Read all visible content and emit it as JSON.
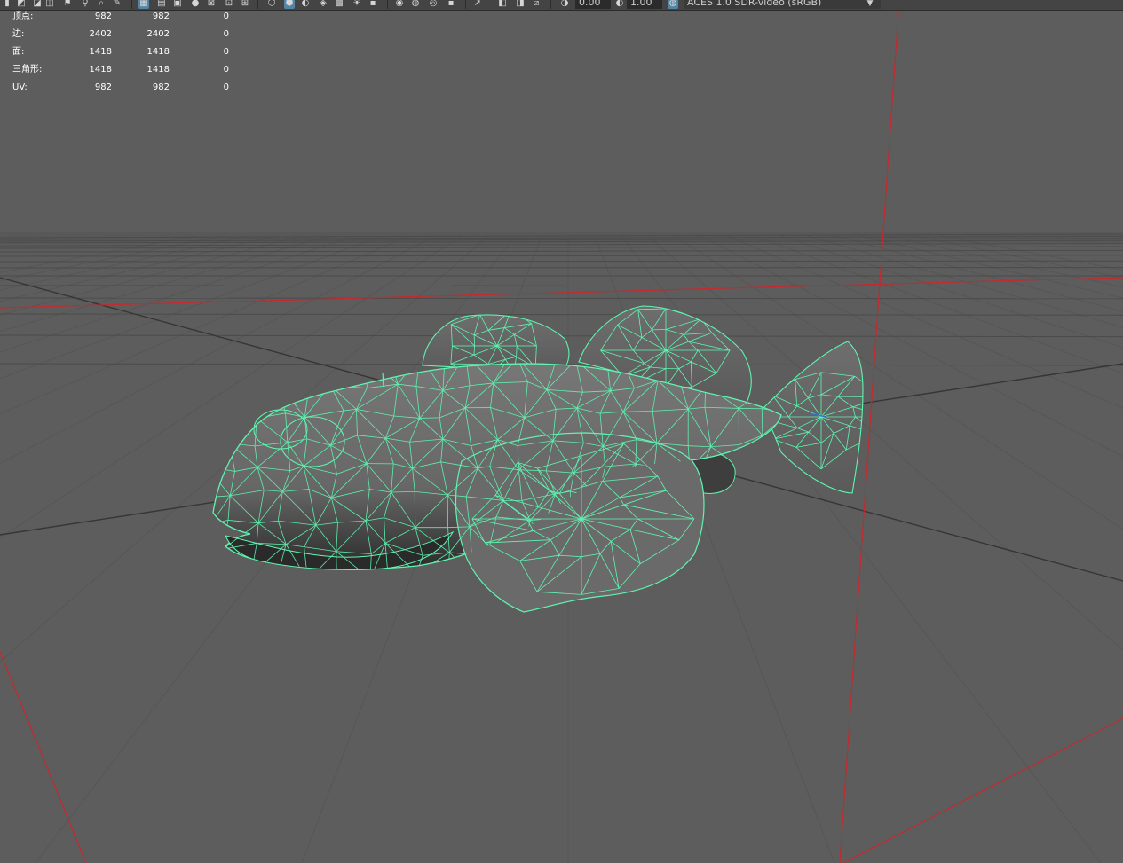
{
  "toolbar": {
    "exposure_value": "0.00",
    "gamma_value": "1.00",
    "colorspace_label": "ACES 1.0 SDR-video (sRGB)",
    "icons": [
      "camera-icon",
      "camera-attributes-icon",
      "bookmark-icon",
      "image-plane-icon",
      "grid-icon",
      "film-gate-icon",
      "resolution-gate-icon",
      "gate-mask-icon",
      "field-chart-icon",
      "safe-action-icon",
      "safe-title-icon",
      "wireframe-icon",
      "smooth-shade-icon",
      "wireframe-on-shaded-icon",
      "textured-icon",
      "use-all-lights-icon",
      "shadows-icon",
      "screen-space-ao-icon",
      "motion-blur-icon",
      "multisample-aa-icon",
      "depth-of-field-icon",
      "isolate-select-icon",
      "xray-icon",
      "xray-joints-icon",
      "backface-culling-icon",
      "exposure-icon",
      "gamma-icon",
      "color-management-icon"
    ]
  },
  "hud": {
    "rows": [
      {
        "label": "顶点:",
        "v1": "982",
        "v2": "982",
        "v3": "0"
      },
      {
        "label": "边:",
        "v1": "2402",
        "v2": "2402",
        "v3": "0"
      },
      {
        "label": "面:",
        "v1": "1418",
        "v2": "1418",
        "v3": "0"
      },
      {
        "label": "三角形:",
        "v1": "1418",
        "v2": "1418",
        "v3": "0"
      },
      {
        "label": "UV:",
        "v1": "982",
        "v2": "982",
        "v3": "0"
      }
    ]
  },
  "colors": {
    "background": "#5d5d5d",
    "grid": "#4a4a4a",
    "axis_dark": "#333333",
    "axis_red": "#c0262a",
    "wire": "#5ff5b0",
    "mesh_fill": "#6a6a6a",
    "toolbar_bg": "#444444",
    "hud_text": "#ffffff"
  }
}
